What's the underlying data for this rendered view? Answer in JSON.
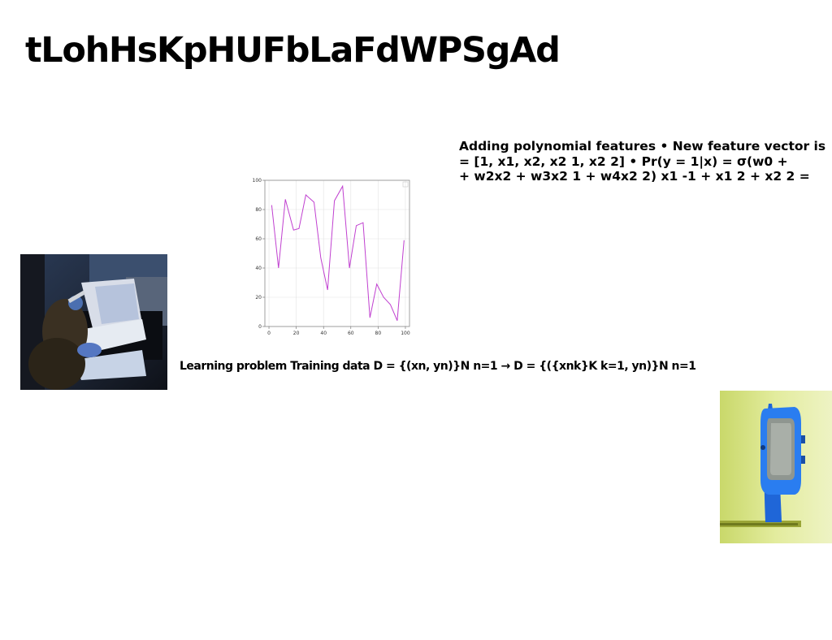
{
  "slide": {
    "title": "tLohHsKpHUFbLaFdWPSgAd",
    "body_lines": [
      "Adding polynomial features • New feature vector is",
      "= [1, x1, x2, x2 1, x2 2] • Pr(y = 1|x) = σ(w0 +",
      "+ w2x2 + w3x2 1 + w4x2 2) x1 -1 + x1 2 + x2 2 ="
    ],
    "caption": "Learning problem Training data D = {(xn, yn)}N n=1 → D = {({xnk}K k=1, yn)}N n=1"
  },
  "images": {
    "left_photo": "person-writing-at-desk-photo",
    "right_photo": "blue-smartwatch-photo"
  },
  "chart_data": {
    "type": "line",
    "x": [
      2,
      7,
      12,
      18,
      22,
      27,
      33,
      38,
      43,
      48,
      54,
      59,
      64,
      69,
      74,
      79,
      84,
      89,
      94,
      99
    ],
    "series": [
      {
        "values": [
          83,
          40,
          87,
          66,
          67,
          90,
          85,
          47,
          25,
          86,
          96,
          40,
          69,
          71,
          6,
          29,
          20,
          15,
          4,
          59
        ]
      }
    ],
    "xlim": [
      -3,
      103
    ],
    "ylim": [
      0,
      100
    ],
    "xticks": [
      "0",
      "20",
      "40",
      "60",
      "80",
      "100"
    ],
    "yticks": [
      "0",
      "20",
      "40",
      "60",
      "80",
      "100"
    ],
    "grid": true,
    "line_color": "#c040d0"
  }
}
